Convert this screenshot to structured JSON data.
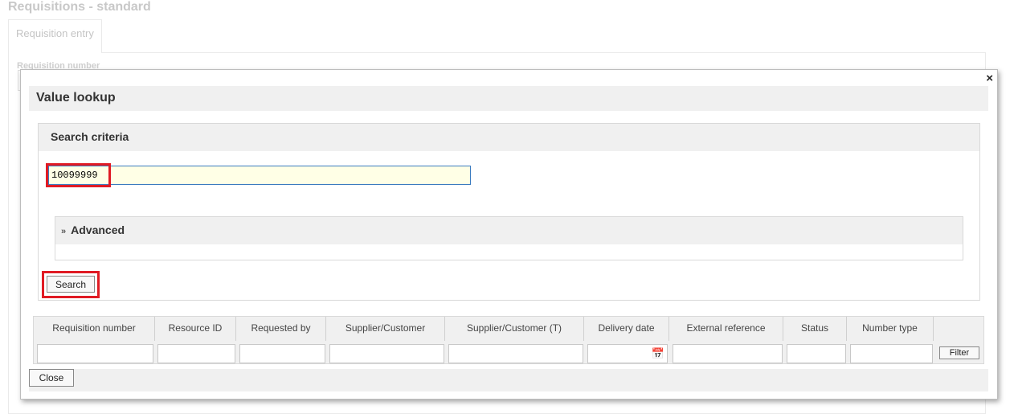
{
  "page": {
    "title": "Requisitions - standard"
  },
  "background": {
    "tab_label": "Requisition entry",
    "field_label": "Requisition number"
  },
  "dialog": {
    "title": "Value lookup",
    "close_icon": "close-icon",
    "search_criteria": {
      "heading": "Search criteria",
      "input_value": "10099999",
      "advanced_label": "Advanced",
      "advanced_icon": "double-chevron-down-icon",
      "search_button": "Search"
    },
    "table": {
      "columns": [
        "Requisition number",
        "Resource ID",
        "Requested by",
        "Supplier/Customer",
        "Supplier/Customer (T)",
        "Delivery date",
        "External reference",
        "Status",
        "Number type"
      ],
      "calendar_icon": "calendar-icon",
      "filter_button": "Filter"
    },
    "close_button": "Close"
  },
  "colors": {
    "highlight": "#e01b24",
    "input_focus_border": "#3b7bbf",
    "input_bg": "#ffffe6",
    "header_bg": "#f0f0f0"
  }
}
